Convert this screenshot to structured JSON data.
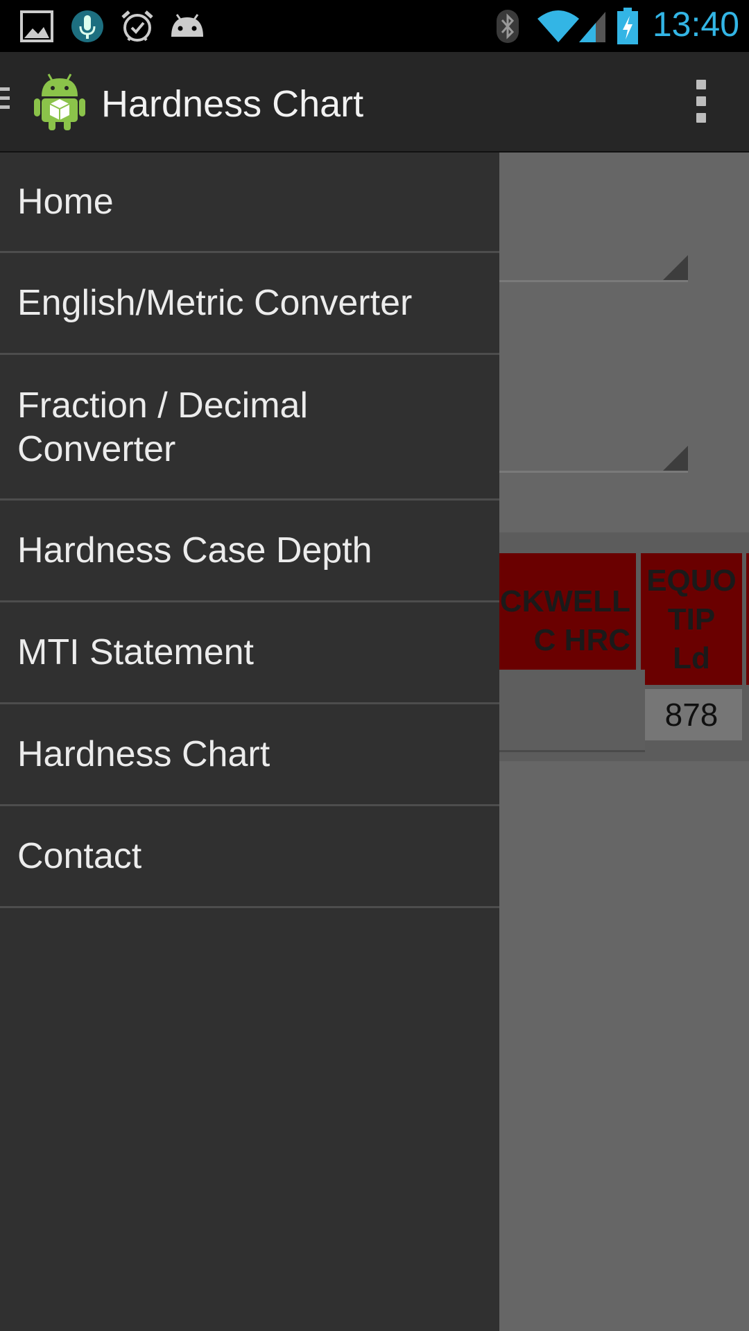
{
  "status_bar": {
    "time": "13:40",
    "icons": [
      "gallery-icon",
      "voice-search-icon",
      "alarm-icon",
      "android-icon",
      "bluetooth-icon",
      "wifi-icon",
      "cell-signal-icon",
      "battery-charging-icon"
    ]
  },
  "action_bar": {
    "title": "Hardness Chart",
    "icon": "android-app-icon"
  },
  "drawer": {
    "items": [
      {
        "label": "Home"
      },
      {
        "label": "English/Metric Converter"
      },
      {
        "label": "Fraction / Decimal\nConverter"
      },
      {
        "label": "Hardness Case Depth"
      },
      {
        "label": "MTI Statement"
      },
      {
        "label": "Hardness Chart"
      },
      {
        "label": "Contact"
      }
    ]
  },
  "background": {
    "table_headers": [
      "ROCKWELL\nC HRC",
      "EQUO\nTIP\nLd"
    ],
    "table_values": [
      "-----",
      "878"
    ]
  },
  "colors": {
    "accent": "#33b5e5",
    "drawer_bg": "#303030",
    "header_red": "#6a0000"
  }
}
